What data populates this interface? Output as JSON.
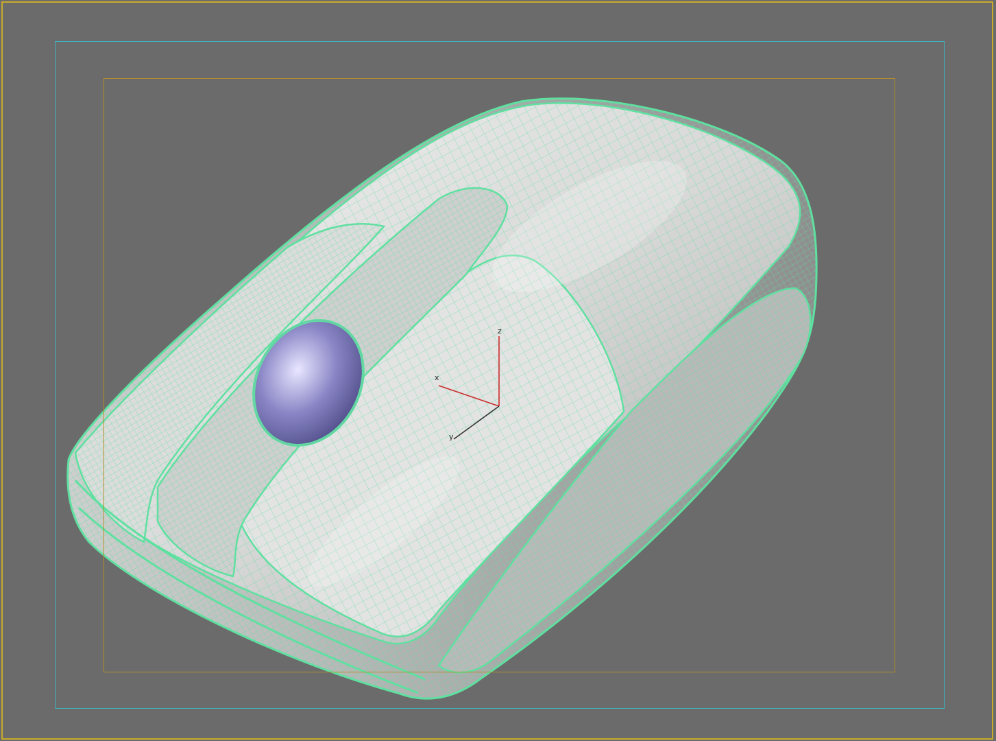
{
  "viewport": {
    "background_color": "#6b6b6b",
    "border_color": "#c8ab2c"
  },
  "safe_frames": {
    "outer_color": "#3fb3bd",
    "inner_color": "#b3902a"
  },
  "model": {
    "wire_color": "#5fe0a0",
    "surface_color": "#d9d9d9",
    "trackball_color": "#7b78b8"
  },
  "gizmo": {
    "x_label": "x",
    "y_label": "y",
    "z_label": "z",
    "x_color": "#cc2a2a",
    "y_color": "#333333",
    "z_color": "#cc2a2a"
  }
}
